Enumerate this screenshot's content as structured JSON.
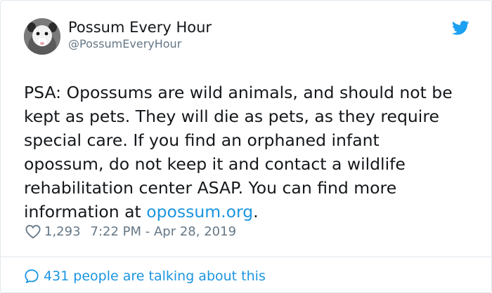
{
  "author": {
    "name": "Possum Every Hour",
    "handle": "@PossumEveryHour",
    "avatar": "possum-avatar"
  },
  "brand_icon": "twitter-bird-icon",
  "tweet": {
    "lines": [
      "PSA: Opossums are wild animals, and should not be",
      "kept as pets. They will die as pets, as they require",
      "special care. If you find an orphaned infant",
      "opossum, do not keep it and contact a wildlife",
      "rehabilitation center ASAP. You can find more"
    ],
    "last_line_prefix": "information at ",
    "link_text": "opossum.org",
    "last_line_suffix": "."
  },
  "meta": {
    "likes_icon": "heart-icon",
    "likes": "1,293",
    "timestamp": "7:22 PM - Apr 28, 2019"
  },
  "footer": {
    "icon": "speech-bubble-icon",
    "talking": "431 people are talking about this"
  },
  "colors": {
    "text": "#14171a",
    "secondary": "#657786",
    "link": "#1b95e0",
    "border": "#e1e8ed"
  }
}
